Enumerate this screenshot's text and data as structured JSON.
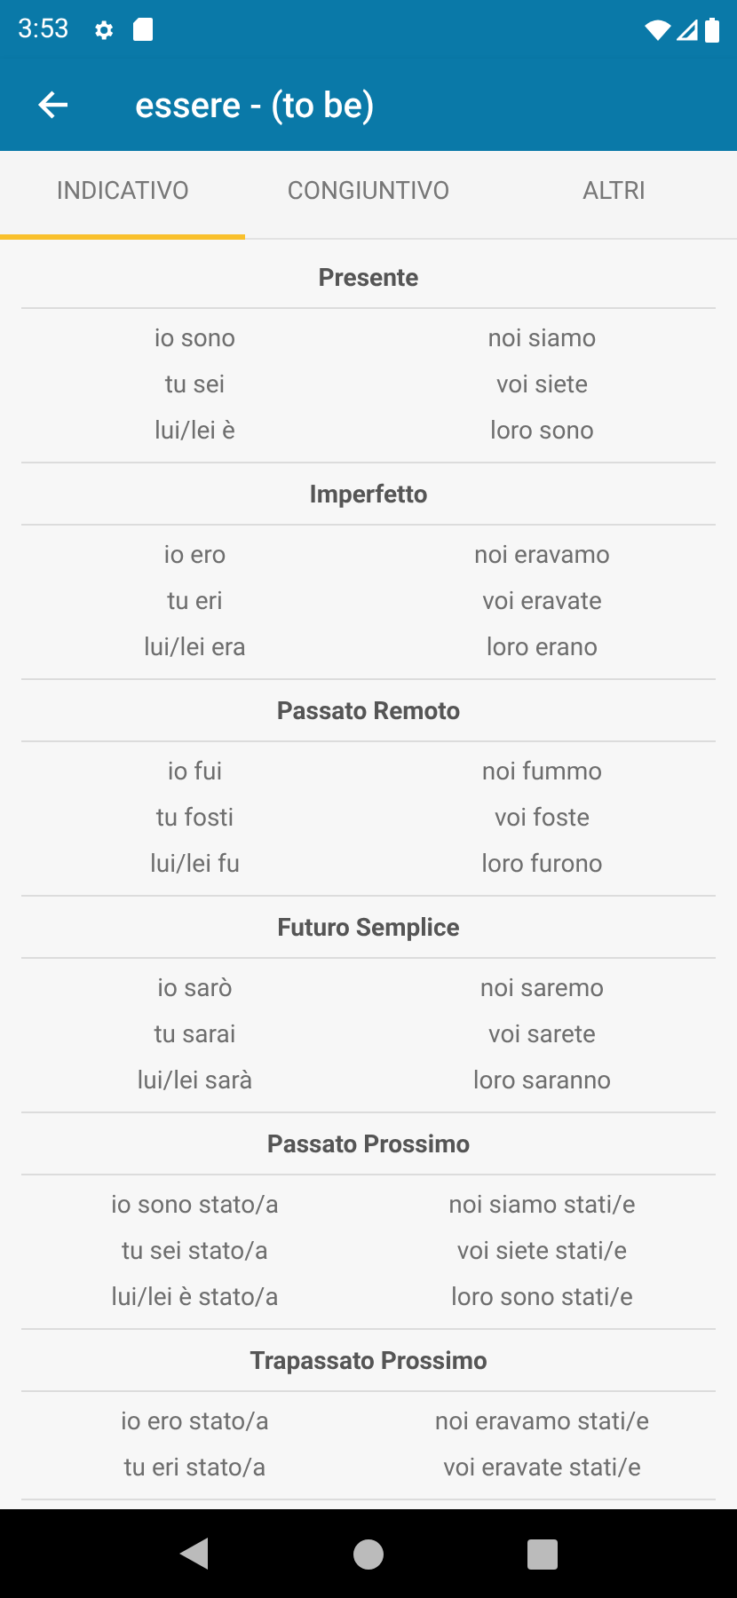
{
  "status_bar": {
    "time": "3:53"
  },
  "app_bar": {
    "title": "essere - (to be)"
  },
  "tabs": [
    {
      "label": "INDICATIVO",
      "selected": true
    },
    {
      "label": "CONGIUNTIVO",
      "selected": false
    },
    {
      "label": "ALTRI",
      "selected": false
    }
  ],
  "sections": [
    {
      "title": "Presente",
      "rows": [
        [
          "io sono",
          "noi siamo"
        ],
        [
          "tu sei",
          "voi siete"
        ],
        [
          "lui/lei è",
          "loro sono"
        ]
      ]
    },
    {
      "title": "Imperfetto",
      "rows": [
        [
          "io ero",
          "noi eravamo"
        ],
        [
          "tu eri",
          "voi eravate"
        ],
        [
          "lui/lei era",
          "loro erano"
        ]
      ]
    },
    {
      "title": "Passato Remoto",
      "rows": [
        [
          "io fui",
          "noi fummo"
        ],
        [
          "tu fosti",
          "voi foste"
        ],
        [
          "lui/lei fu",
          "loro furono"
        ]
      ]
    },
    {
      "title": "Futuro Semplice",
      "rows": [
        [
          "io sarò",
          "noi saremo"
        ],
        [
          "tu sarai",
          "voi sarete"
        ],
        [
          "lui/lei sarà",
          "loro saranno"
        ]
      ]
    },
    {
      "title": "Passato Prossimo",
      "rows": [
        [
          "io sono stato/a",
          "noi siamo stati/e"
        ],
        [
          "tu sei stato/a",
          "voi siete stati/e"
        ],
        [
          "lui/lei è stato/a",
          "loro sono stati/e"
        ]
      ]
    },
    {
      "title": "Trapassato Prossimo",
      "rows": [
        [
          "io ero stato/a",
          "noi eravamo stati/e"
        ],
        [
          "tu eri stato/a",
          "voi eravate stati/e"
        ]
      ]
    }
  ]
}
